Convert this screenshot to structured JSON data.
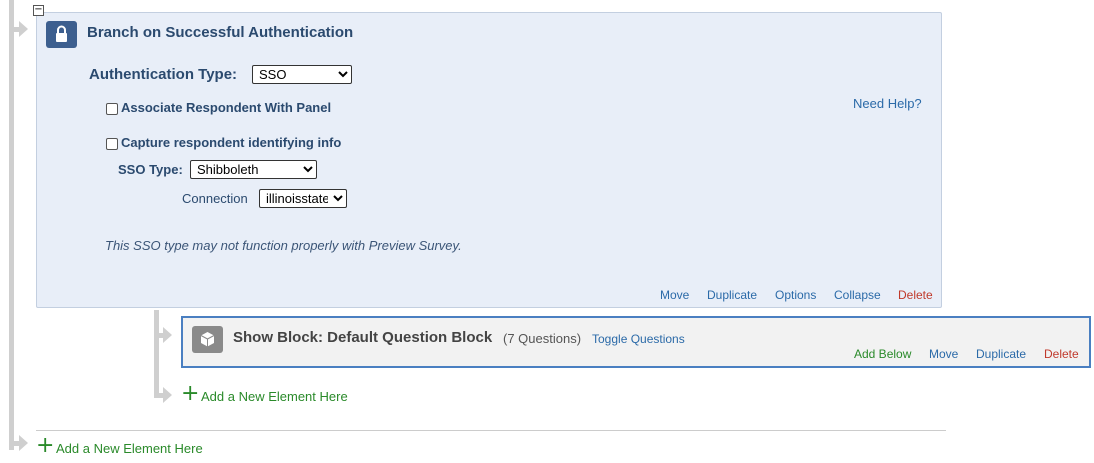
{
  "branch": {
    "title": "Branch on Successful Authentication",
    "auth_type_label": "Authentication Type:",
    "auth_type_value": "SSO",
    "associate_label": "Associate Respondent With Panel",
    "capture_label": "Capture respondent identifying info",
    "need_help": "Need Help?",
    "sso_type_label": "SSO Type:",
    "sso_type_value": "Shibboleth",
    "connection_label": "Connection",
    "connection_value": "illinoisstate",
    "note": "This SSO type may not function properly with Preview Survey.",
    "actions": {
      "move": "Move",
      "duplicate": "Duplicate",
      "options": "Options",
      "collapse": "Collapse",
      "delete": "Delete"
    }
  },
  "block": {
    "title": "Show Block: Default Question Block",
    "count": "(7 Questions)",
    "toggle": "Toggle Questions",
    "actions": {
      "add_below": "Add Below",
      "move": "Move",
      "duplicate": "Duplicate",
      "delete": "Delete"
    }
  },
  "add_inner": "Add a New Element Here",
  "add_outer": "Add a New Element Here",
  "icons": {
    "collapse": "collapse-minus-icon",
    "lock": "lock-icon",
    "cube": "cube-icon",
    "plus": "plus-icon",
    "arrow": "flow-arrow-icon"
  },
  "colors": {
    "branch_bg": "#e8eef8",
    "badge_blue": "#3d5f8f",
    "link_blue": "#2b6aa8",
    "delete_red": "#c0392b",
    "add_green": "#2a8a2a",
    "block_border": "#4a7fc1"
  }
}
